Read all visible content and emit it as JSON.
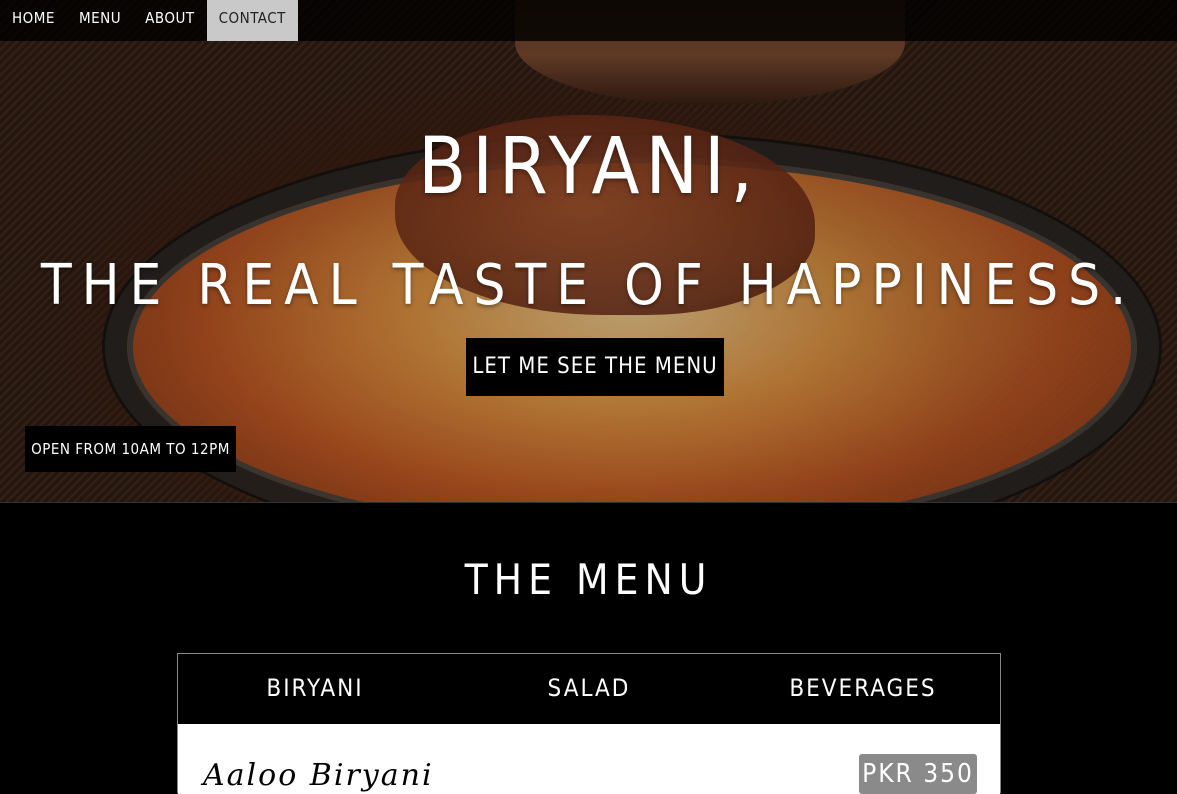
{
  "nav": {
    "items": [
      {
        "label": "HOME"
      },
      {
        "label": "MENU"
      },
      {
        "label": "ABOUT"
      },
      {
        "label": "CONTACT"
      }
    ],
    "active": "CONTACT"
  },
  "hero": {
    "title": "BIRYANI,",
    "subtitle": "THE REAL TASTE OF HAPPINESS.",
    "cta_label": "LET ME SEE THE MENU",
    "hours": "OPEN FROM 10AM TO 12PM"
  },
  "menu": {
    "heading": "THE MENU",
    "tabs": [
      {
        "label": "BIRYANI"
      },
      {
        "label": "SALAD"
      },
      {
        "label": "BEVERAGES"
      }
    ],
    "items": [
      {
        "name": "Aaloo Biryani",
        "price": "PKR 350"
      }
    ]
  }
}
